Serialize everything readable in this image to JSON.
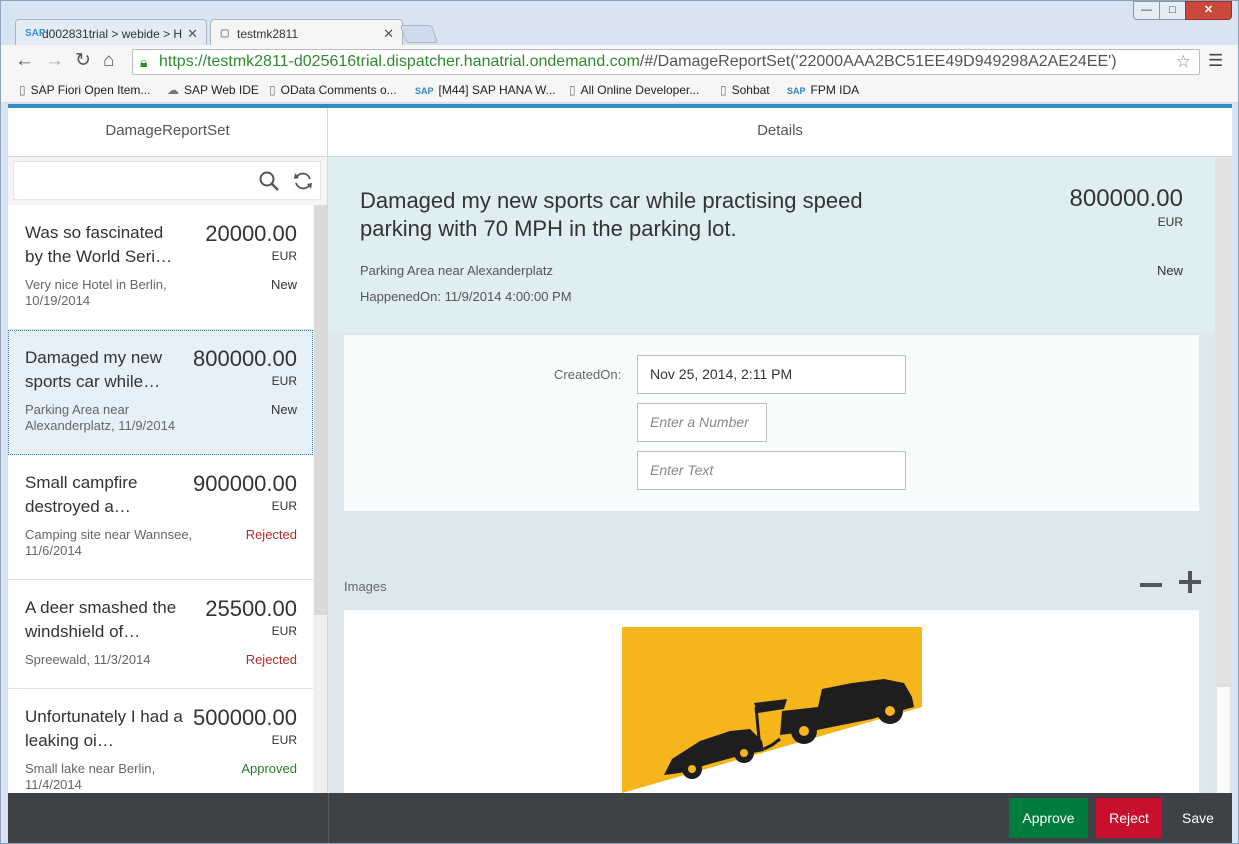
{
  "browser": {
    "tabs": [
      {
        "label": "d002831trial > webide > H"
      },
      {
        "label": "testmk2811"
      }
    ],
    "window_controls": {
      "minimize": "—",
      "maximize": "□",
      "close": "✕"
    },
    "url": {
      "scheme": "https://",
      "host": "testmk2811-d025616trial.dispatcher.hanatrial.ondemand.com",
      "path": "/#/DamageReportSet('22000AAA2BC51EE49D949298A2AE24EE')"
    },
    "bookmarks": [
      {
        "label": "SAP Fiori Open Item..."
      },
      {
        "label": "SAP Web IDE"
      },
      {
        "label": "OData Comments o..."
      },
      {
        "label": "[M44] SAP HANA W..."
      },
      {
        "label": "All Online Developer..."
      },
      {
        "label": "Sohbat"
      },
      {
        "label": "FPM IDA"
      }
    ]
  },
  "master": {
    "title": "DamageReportSet",
    "items": [
      {
        "title": "Was so fascinated by the World Seri…",
        "amount": "20000.00",
        "currency": "EUR",
        "description": "Very nice Hotel in Berlin, 10/19/2014",
        "status": "New"
      },
      {
        "title": "Damaged my new sports car while…",
        "amount": "800000.00",
        "currency": "EUR",
        "description": "Parking Area near Alexanderplatz, 11/9/2014",
        "status": "New"
      },
      {
        "title": "Small campfire destroyed a…",
        "amount": "900000.00",
        "currency": "EUR",
        "description": "Camping site near Wannsee, 11/6/2014",
        "status": "Rejected"
      },
      {
        "title": "A deer smashed the windshield of…",
        "amount": "25500.00",
        "currency": "EUR",
        "description": "Spreewald, 11/3/2014",
        "status": "Rejected"
      },
      {
        "title": "Unfortunately I had a leaking oi…",
        "amount": "500000.00",
        "currency": "EUR",
        "description": "Small lake near Berlin, 11/4/2014",
        "status": "Approved"
      }
    ]
  },
  "detail": {
    "title": "Details",
    "header": {
      "title": "Damaged my new sports car while practising speed parking with 70 MPH in the parking lot.",
      "amount": "800000.00",
      "currency": "EUR",
      "location": "Parking Area near Alexanderplatz",
      "status": "New",
      "happened": "HappenedOn: 11/9/2014 4:00:00 PM"
    },
    "form": {
      "created_label": "CreatedOn:",
      "created_value": "Nov 25, 2014, 2:11 PM",
      "number_placeholder": "Enter a Number",
      "text_placeholder": "Enter Text"
    },
    "images_label": "Images"
  },
  "footer": {
    "approve": "Approve",
    "reject": "Reject",
    "save": "Save"
  },
  "colors": {
    "accent": "#2d8dc4",
    "approve": "#007d3c",
    "reject": "#c8102e",
    "rejected_text": "#b32d2d",
    "approved_text": "#2b7d2b",
    "image_background": "#f7b51c"
  }
}
